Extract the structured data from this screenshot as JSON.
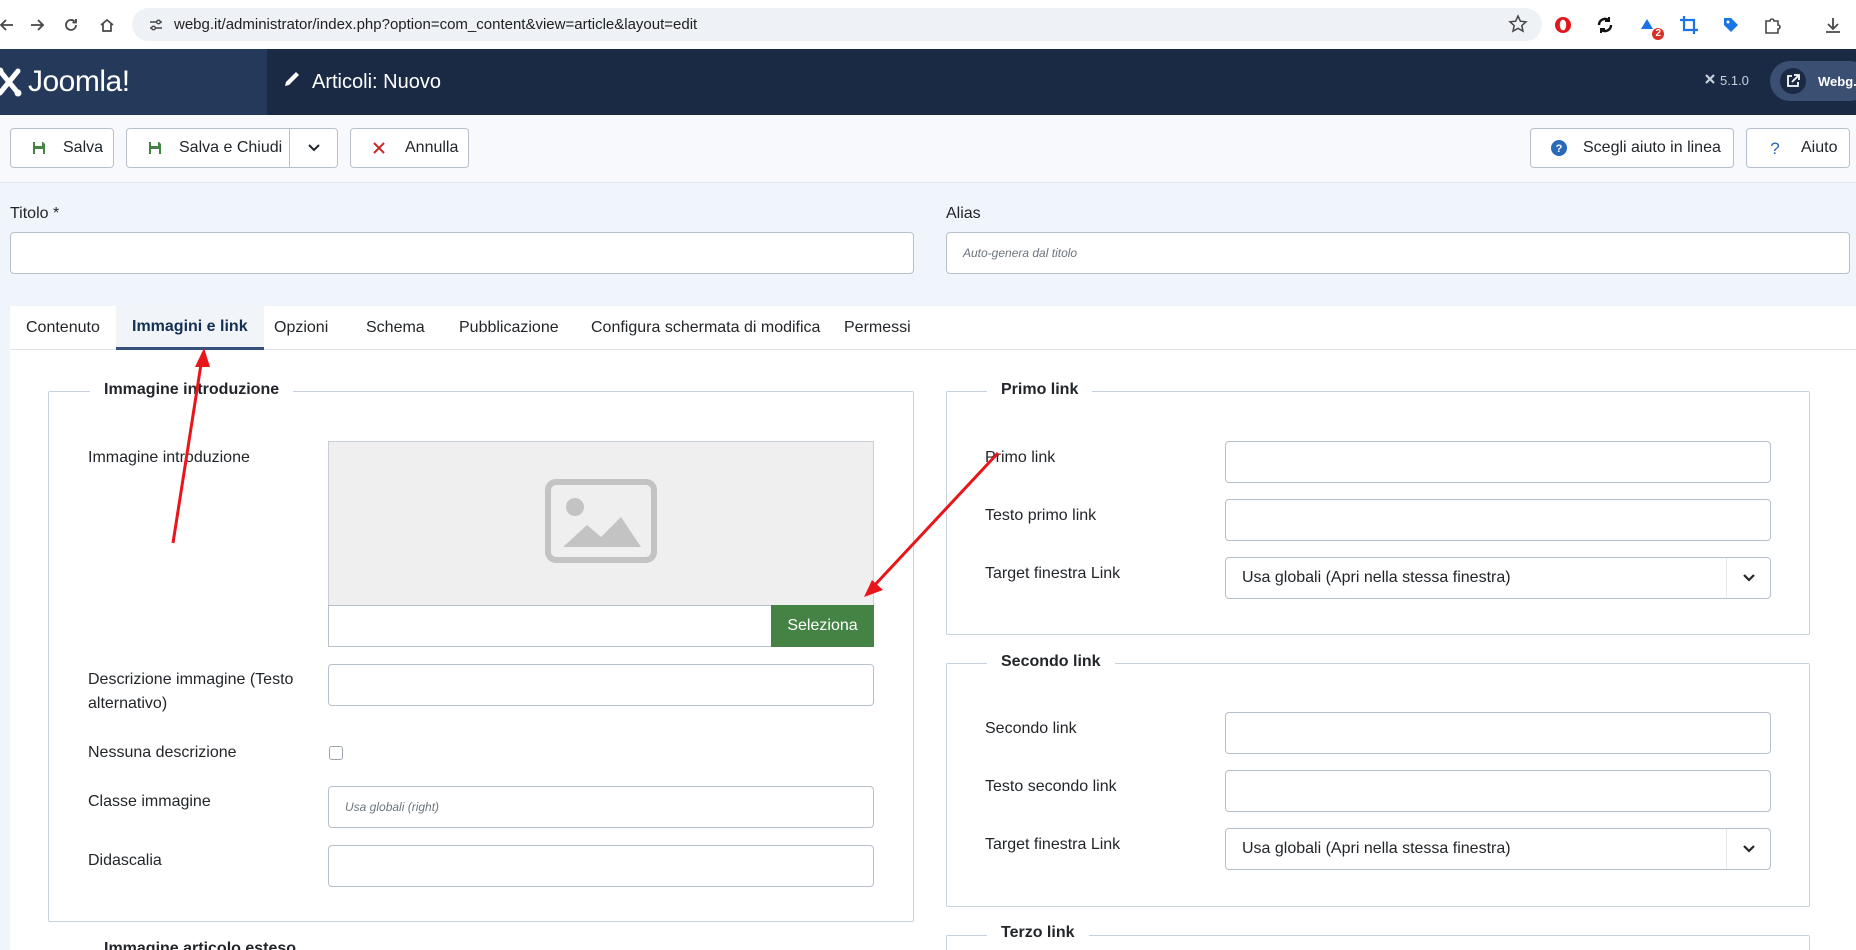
{
  "browser": {
    "url": "webg.it/administrator/index.php?option=com_content&view=article&layout=edit",
    "extension_badge": "2"
  },
  "header": {
    "logo_text": "Joomla!",
    "page_title": "Articoli: Nuovo",
    "version": "5.1.0",
    "site_label": "Webg.it"
  },
  "toolbar": {
    "save": "Salva",
    "save_close": "Salva e Chiudi",
    "cancel": "Annulla",
    "help_online": "Scegli aiuto in linea",
    "help": "Aiuto"
  },
  "form": {
    "title_label": "Titolo *",
    "title_value": "",
    "alias_label": "Alias",
    "alias_placeholder": "Auto-genera dal titolo"
  },
  "tabs": [
    "Contenuto",
    "Immagini e link",
    "Opzioni",
    "Schema",
    "Pubblicazione",
    "Configura schermata di modifica",
    "Permessi"
  ],
  "active_tab": "Immagini e link",
  "intro_image": {
    "legend": "Immagine introduzione",
    "image_label": "Immagine introduzione",
    "select_button": "Seleziona",
    "alt_label": "Descrizione immagine (Testo alternativo)",
    "no_desc_label": "Nessuna descrizione",
    "no_desc_checked": false,
    "class_label": "Classe immagine",
    "class_placeholder": "Usa globali (right)",
    "caption_label": "Didascalia"
  },
  "full_image": {
    "legend": "Immagine articolo esteso"
  },
  "link_a": {
    "legend": "Primo link",
    "url_label": "Primo link",
    "text_label": "Testo primo link",
    "target_label": "Target finestra Link",
    "target_value": "Usa globali (Apri nella stessa finestra)"
  },
  "link_b": {
    "legend": "Secondo link",
    "url_label": "Secondo link",
    "text_label": "Testo secondo link",
    "target_label": "Target finestra Link",
    "target_value": "Usa globali (Apri nella stessa finestra)"
  },
  "link_c": {
    "legend": "Terzo link"
  },
  "colors": {
    "header_bg": "#1b2a44",
    "select_green": "#448344",
    "annotation_red": "#e8161b"
  }
}
